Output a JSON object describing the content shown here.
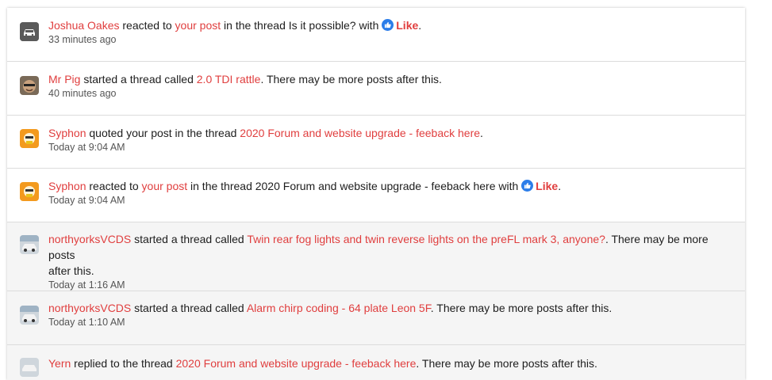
{
  "alerts": [
    {
      "user": "Joshua Oakes",
      "text1": " reacted to ",
      "link1": "your post",
      "text2": " in the thread Is it possible? with ",
      "reaction": "Like",
      "end": ".",
      "time": "33 minutes ago",
      "avatar_icon": "car-icon"
    },
    {
      "user": "Mr Pig",
      "text1": " started a thread called ",
      "link1": "2.0 TDI rattle",
      "text2": ". There may be more posts after this.",
      "time": "40 minutes ago",
      "avatar_icon": "mr-pig-avatar"
    },
    {
      "user": "Syphon",
      "text1": " quoted your post in the thread ",
      "link1": "2020 Forum and website upgrade - feeback here",
      "text2": ".",
      "time": "Today at 9:04 AM",
      "avatar_icon": "syphon-avatar"
    },
    {
      "user": "Syphon",
      "text1": " reacted to ",
      "link1": "your post",
      "text2": " in the thread 2020 Forum and website upgrade - feeback here with ",
      "reaction": "Like",
      "end": ".",
      "time": "Today at 9:04 AM",
      "avatar_icon": "syphon-avatar"
    },
    {
      "user": "northyorksVCDS",
      "text1": " started a thread called ",
      "link1": "Twin rear fog lights and twin reverse lights on the preFL mark 3, anyone?",
      "text2": ". There may be more posts",
      "text3": "after this.",
      "time": "Today at 1:16 AM",
      "avatar_icon": "northyorks-avatar"
    },
    {
      "user": "northyorksVCDS",
      "text1": " started a thread called ",
      "link1": "Alarm chirp coding - 64 plate Leon 5F",
      "text2": ". There may be more posts after this.",
      "time": "Today at 1:10 AM",
      "avatar_icon": "northyorks-avatar"
    },
    {
      "user": "Yern",
      "text1": " replied to the thread ",
      "link1": "2020 Forum and website upgrade - feeback here",
      "text2": ". There may be more posts after this.",
      "avatar_icon": "yern-avatar"
    }
  ],
  "colors": {
    "link": "#e03e3e",
    "like_badge": "#2b7de9",
    "read_background": "#f5f5f5"
  }
}
